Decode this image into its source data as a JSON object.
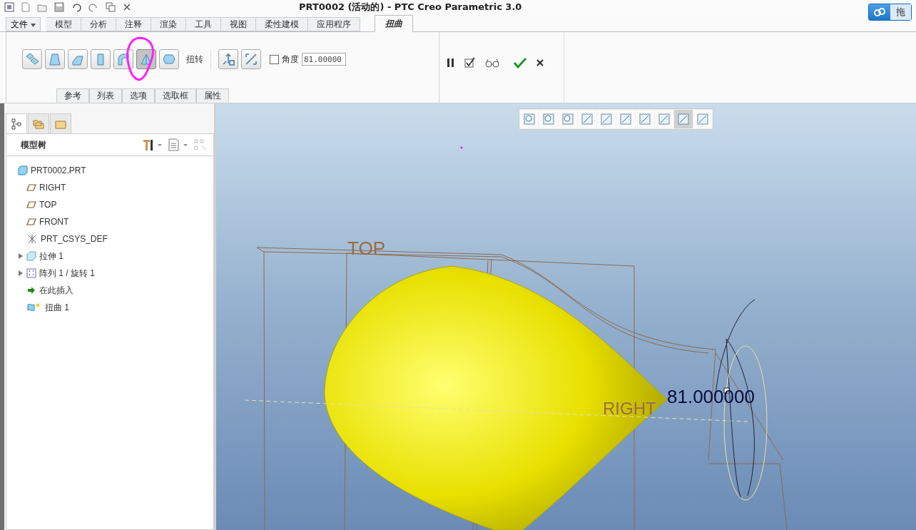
{
  "window": {
    "title": "PRT0002 (活动的) - PTC Creo Parametric 3.0"
  },
  "cloud_button": {
    "label": "拖"
  },
  "file_menu": {
    "label": "文件"
  },
  "tabs": [
    {
      "label": "模型",
      "selected": false
    },
    {
      "label": "分析",
      "selected": false
    },
    {
      "label": "注释",
      "selected": false
    },
    {
      "label": "渲染",
      "selected": false
    },
    {
      "label": "工具",
      "selected": false
    },
    {
      "label": "视图",
      "selected": false
    },
    {
      "label": "柔性建模",
      "selected": false
    },
    {
      "label": "应用程序",
      "selected": false
    },
    {
      "label": "扭曲",
      "selected": true
    }
  ],
  "ribbon": {
    "tools": [
      {
        "kind": "transform",
        "selected": false
      },
      {
        "kind": "warp",
        "selected": false
      },
      {
        "kind": "spine",
        "selected": false
      },
      {
        "kind": "stretch",
        "selected": false
      },
      {
        "kind": "bend",
        "selected": false
      },
      {
        "kind": "twist",
        "selected": true
      },
      {
        "kind": "sculpt",
        "selected": false
      }
    ],
    "tool_label": "扭转",
    "angle": {
      "label": "角度",
      "checked": false,
      "value": "81.00000"
    },
    "panels": [
      "参考",
      "列表",
      "选项",
      "选取框",
      "属性"
    ]
  },
  "model_tree": {
    "panel_tabs": [
      {
        "kind": "tree",
        "selected": true
      },
      {
        "kind": "folders",
        "selected": false
      },
      {
        "kind": "favorites",
        "selected": false
      }
    ],
    "title": "模型树",
    "items": [
      {
        "label": "PRT0002.PRT",
        "kind": "part",
        "children": [
          {
            "label": "RIGHT",
            "kind": "plane",
            "expandable": false
          },
          {
            "label": "TOP",
            "kind": "plane",
            "expandable": false
          },
          {
            "label": "FRONT",
            "kind": "plane",
            "expandable": false
          },
          {
            "label": "PRT_CSYS_DEF",
            "kind": "csys",
            "expandable": false
          },
          {
            "label": "拉伸 1",
            "kind": "extrude",
            "expandable": true
          },
          {
            "label": "阵列 1 / 旋转 1",
            "kind": "pattern",
            "expandable": true
          },
          {
            "label": "在此插入",
            "kind": "insert",
            "expandable": false
          },
          {
            "label": "扭曲 1",
            "kind": "warp",
            "expandable": false
          }
        ]
      }
    ]
  },
  "viewport": {
    "plane_labels": [
      "TOP",
      "RIGHT"
    ],
    "dimension": "81.000000"
  }
}
